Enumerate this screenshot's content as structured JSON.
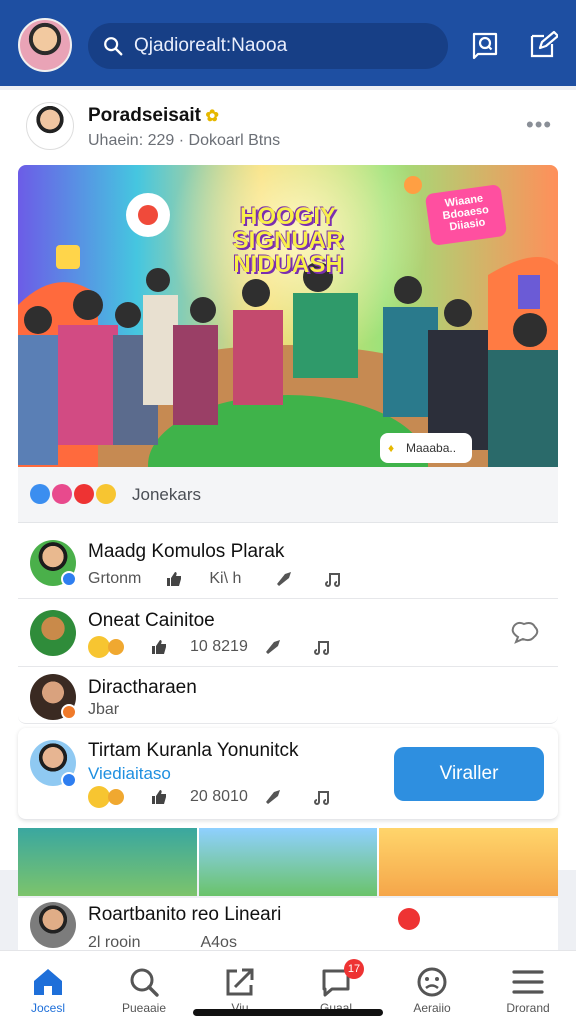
{
  "header": {
    "search_text": "Qjadiorealt:Naooa"
  },
  "post": {
    "author_name": "Poradseisait",
    "author_sub": "Uhaein: 229 · Dokoarl Btns",
    "banner_title_1": "HOOGIY",
    "banner_title_2": "SIGNUAR",
    "banner_title_3": "NIDUASH",
    "banner_bubble": "Wiaane Bdoaeso Diiasio",
    "banner_tag": "Maaaba..",
    "reactions_label": "Jonekars"
  },
  "comments": [
    {
      "title": "Maadg Komulos Plarak",
      "meta_1": "Grtonm",
      "meta_2": "Ki\\ h"
    },
    {
      "title": "Oneat Cainitoe",
      "meta_2": "10 8219"
    },
    {
      "title": "Diractharaen",
      "meta_1": "Jbar"
    },
    {
      "title": "Tirtam Kuranla  Yonunitck",
      "subtitle": "Viediaitaso",
      "meta_2": "20 8010",
      "button_label": "Viraller"
    },
    {
      "title": "Roartbanito reo Lineari",
      "meta_1": "2l rooin",
      "meta_2": "A4os"
    }
  ],
  "tabs": [
    {
      "label": "Jocesl"
    },
    {
      "label": "Pueaaie"
    },
    {
      "label": "Viu"
    },
    {
      "label": "Guaal",
      "badge": "17"
    },
    {
      "label": "Aeraiio"
    },
    {
      "label": "Drorand"
    }
  ],
  "colors": {
    "header_bg": "#1e4fa2",
    "accent": "#2e8fe0",
    "active_tab": "#1e6fd9"
  }
}
